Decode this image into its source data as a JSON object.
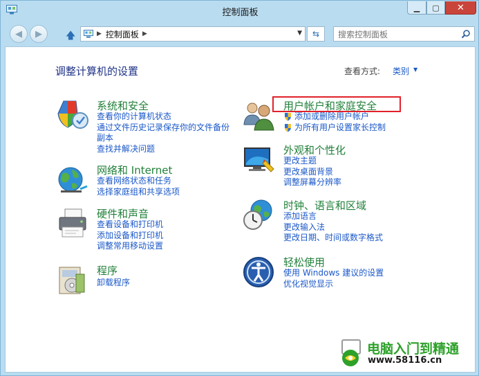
{
  "window": {
    "title": "控制面板",
    "minimize_icon": "minimize-icon",
    "maximize_icon": "maximize-icon",
    "close_icon": "close-icon"
  },
  "nav": {
    "back_icon": "back-arrow-icon",
    "forward_icon": "forward-arrow-icon",
    "up_icon": "up-arrow-icon",
    "breadcrumb": [
      "控制面板"
    ],
    "refresh_icon": "refresh-icon",
    "search_placeholder": "搜索控制面板"
  },
  "main": {
    "heading": "调整计算机的设置",
    "view_by_label": "查看方式:",
    "view_by_value": "类别"
  },
  "categories_left": [
    {
      "icon": "shield-check-icon",
      "title": "系统和安全",
      "links": [
        "查看你的计算机状态",
        "通过文件历史记录保存你的文件备份",
        "副本",
        "查找并解决问题"
      ]
    },
    {
      "icon": "network-globe-icon",
      "title": "网络和 Internet",
      "links": [
        "查看网络状态和任务",
        "选择家庭组和共享选项"
      ]
    },
    {
      "icon": "printer-icon",
      "title": "硬件和声音",
      "links": [
        "查看设备和打印机",
        "添加设备和打印机",
        "调整常用移动设置"
      ]
    },
    {
      "icon": "programs-icon",
      "title": "程序",
      "links": [
        "卸载程序"
      ]
    }
  ],
  "categories_right": [
    {
      "icon": "users-icon",
      "title": "用户帐户和家庭安全",
      "links": [
        "添加或删除用户帐户",
        "为所有用户设置家长控制"
      ],
      "highlighted": true
    },
    {
      "icon": "display-icon",
      "title": "外观和个性化",
      "links": [
        "更改主题",
        "更改桌面背景",
        "调整屏幕分辨率"
      ]
    },
    {
      "icon": "clock-globe-icon",
      "title": "时钟、语言和区域",
      "links": [
        "添加语言",
        "更改输入法",
        "更改日期、时间或数字格式"
      ]
    },
    {
      "icon": "ease-of-access-icon",
      "title": "轻松使用",
      "links": [
        "使用 Windows 建议的设置",
        "优化视觉显示"
      ]
    }
  ],
  "watermark": {
    "title": "电脑入门到精通",
    "url": "www.58116.cn"
  },
  "colors": {
    "category_title": "#21803a",
    "link": "#1b58c9",
    "heading": "#1e3287",
    "highlight": "#e0212a",
    "window_frame": "#b9dcf0"
  }
}
